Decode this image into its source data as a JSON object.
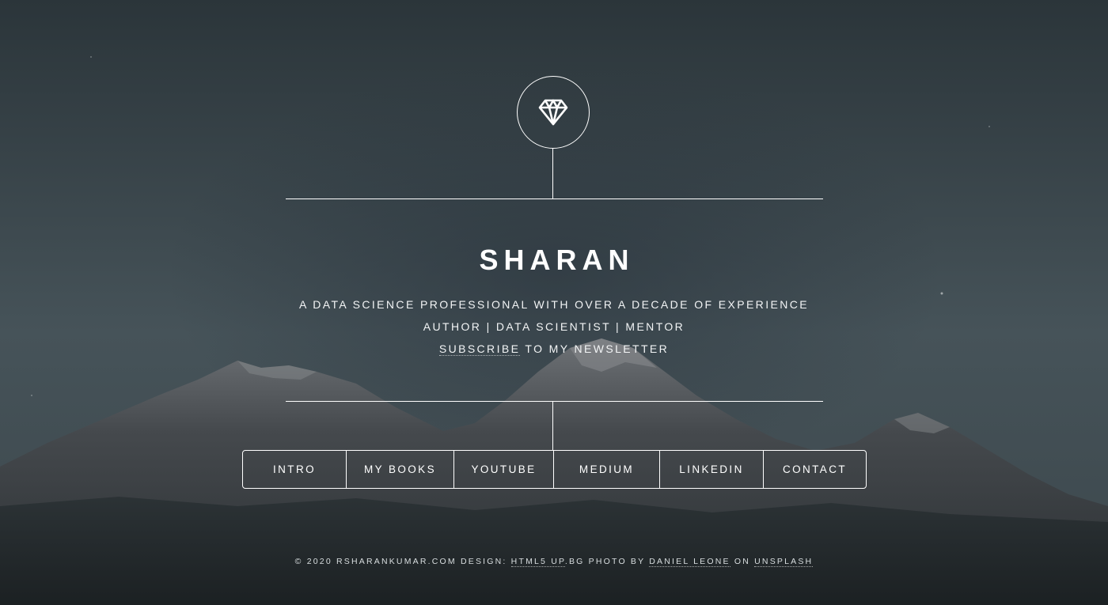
{
  "site": {
    "logo_icon": "diamond-icon",
    "name": "SHARAN"
  },
  "intro": {
    "line1": "A DATA SCIENCE PROFESSIONAL WITH OVER A DECADE OF EXPERIENCE",
    "line2": "AUTHOR | DATA SCIENTIST | MENTOR",
    "subscribe_link": "SUBSCRIBE",
    "subscribe_rest": " TO MY NEWSLETTER"
  },
  "nav": {
    "items": [
      {
        "label": "INTRO"
      },
      {
        "label": "MY BOOKS"
      },
      {
        "label": "YOUTUBE"
      },
      {
        "label": "MEDIUM"
      },
      {
        "label": "LINKEDIN"
      },
      {
        "label": "CONTACT"
      }
    ]
  },
  "footer": {
    "copyright": "© 2020 RSHARANKUMAR.COM DESIGN: ",
    "design_link": "HTML5 UP",
    "design_rest": ".BG PHOTO BY ",
    "photographer_link": "DANIEL LEONE",
    "on_text": " ON ",
    "unsplash_link": "UNSPLASH"
  },
  "colors": {
    "sky_top": "#2e383d",
    "sky_mid": "#4a575d",
    "mountain": "#3d4448",
    "foreground": "#1e2426",
    "line": "#ffffff"
  }
}
